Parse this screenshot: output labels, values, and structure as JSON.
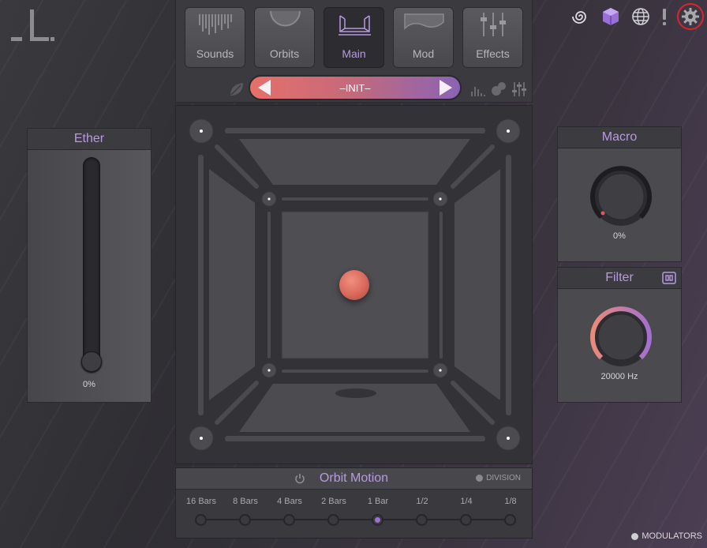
{
  "tabs": [
    {
      "label": "Sounds",
      "icon": "sounds-icon"
    },
    {
      "label": "Orbits",
      "icon": "orbits-icon"
    },
    {
      "label": "Main",
      "icon": "main-icon",
      "active": true
    },
    {
      "label": "Mod",
      "icon": "mod-icon"
    },
    {
      "label": "Effects",
      "icon": "effects-icon"
    }
  ],
  "preset": {
    "name": "–INIT–"
  },
  "ether": {
    "title": "Ether",
    "value": "0%",
    "level": 0
  },
  "macro": {
    "title": "Macro",
    "value": "0%"
  },
  "filter": {
    "title": "Filter",
    "value": "20000 Hz"
  },
  "orbit_motion": {
    "title": "Orbit Motion",
    "division_label": "DIVISION",
    "divisions": [
      "16 Bars",
      "8 Bars",
      "4 Bars",
      "2 Bars",
      "1 Bar",
      "1/2",
      "1/4",
      "1/8"
    ],
    "selected_index": 4
  },
  "modulators_label": "MODULATORS",
  "colors": {
    "accent": "#b79ae0",
    "puck": "#d9685a",
    "highlight_ring": "#d8262a"
  }
}
